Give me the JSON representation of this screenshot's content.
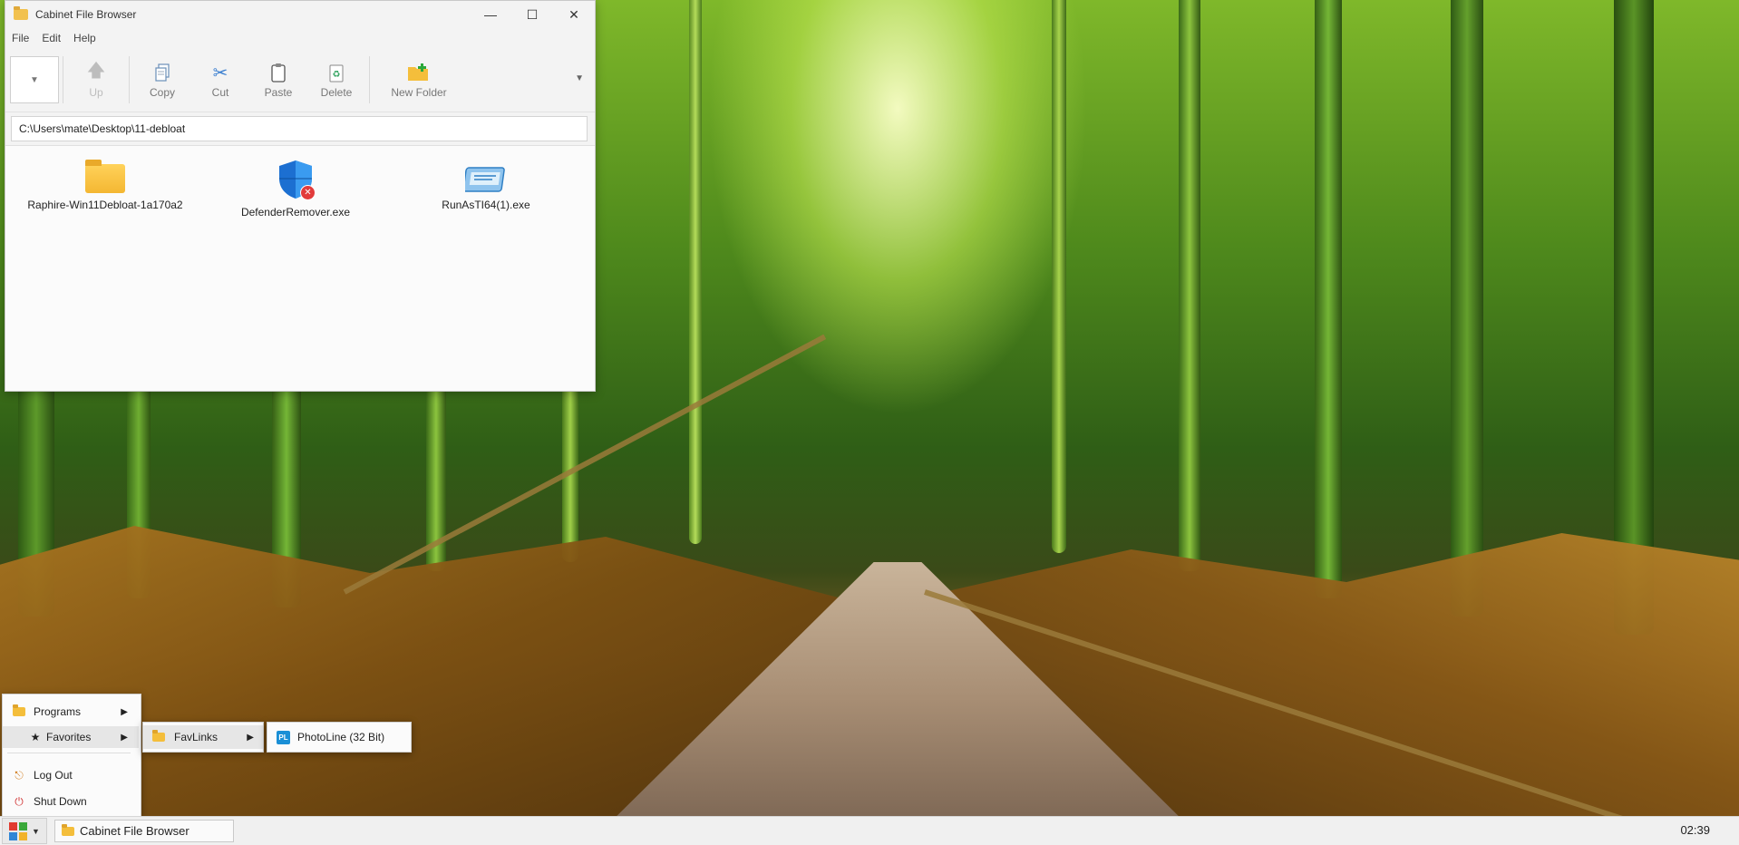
{
  "window": {
    "title": "Cabinet File Browser",
    "controls": {
      "minimize": "—",
      "maximize": "☐",
      "close": "✕"
    },
    "menu": [
      "File",
      "Edit",
      "Help"
    ],
    "toolbar": {
      "up": "Up",
      "copy": "Copy",
      "cut": "Cut",
      "paste": "Paste",
      "delete": "Delete",
      "new_folder": "New Folder"
    },
    "address": "C:\\Users\\mate\\Desktop\\11-debloat",
    "files": [
      {
        "name": "Raphire-Win11Debloat-1a170a2",
        "icon": "folder-icon"
      },
      {
        "name": "DefenderRemover.exe",
        "icon": "defender-shield-icon"
      },
      {
        "name": "RunAsTI64(1).exe",
        "icon": "executable-icon"
      }
    ]
  },
  "start_menu": {
    "items": [
      {
        "label": "Programs",
        "icon": "folder-icon"
      },
      {
        "label": "Favorites",
        "icon": "star-icon"
      },
      {
        "label": "Log Out",
        "icon": "logout-icon"
      },
      {
        "label": "Shut Down",
        "icon": "power-icon"
      }
    ],
    "favorites_submenu": {
      "label": "FavLinks",
      "icon": "folder-icon"
    },
    "favlinks_submenu": {
      "label": "PhotoLine (32 Bit)",
      "icon": "photoline-icon",
      "icon_text": "PL"
    }
  },
  "taskbar": {
    "task_label": "Cabinet File Browser",
    "clock": "02:39"
  }
}
